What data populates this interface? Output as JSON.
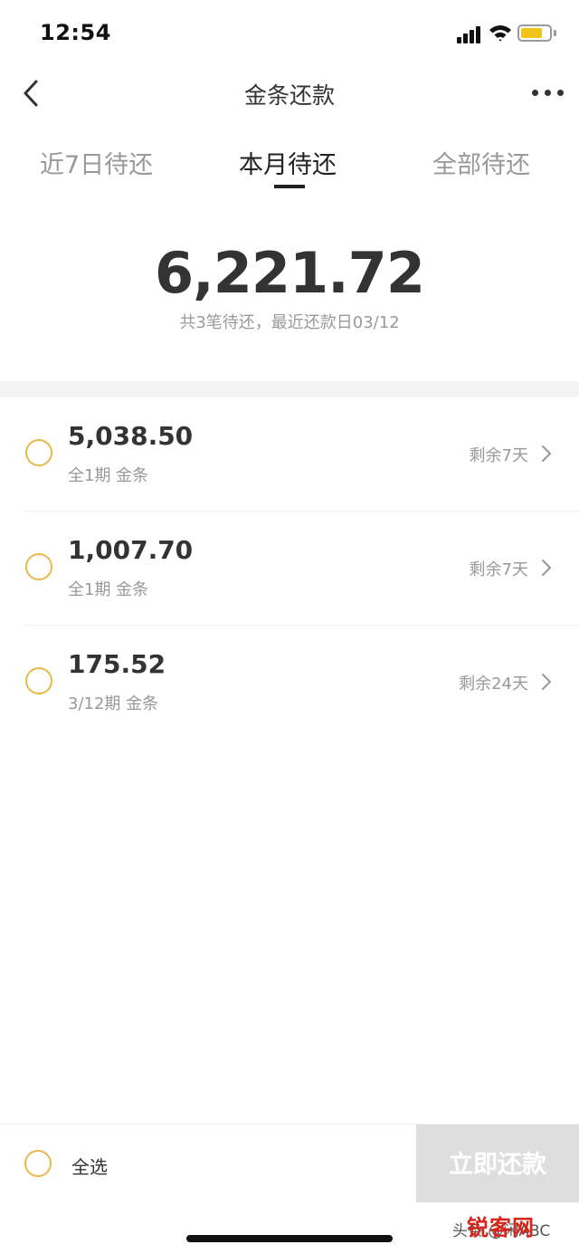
{
  "status_bar": {
    "time": "12:54",
    "battery_level": 0.75
  },
  "nav": {
    "title": "金条还款"
  },
  "tabs": [
    {
      "label": "近7日待还",
      "active": false
    },
    {
      "label": "本月待还",
      "active": true
    },
    {
      "label": "全部待还",
      "active": false
    }
  ],
  "summary": {
    "total_amount": "6,221.72",
    "subtitle": "共3笔待还，最近还款日03/12"
  },
  "bills": [
    {
      "amount": "5,038.50",
      "desc": "全1期  金条",
      "remaining": "剩余7天"
    },
    {
      "amount": "1,007.70",
      "desc": "全1期  金条",
      "remaining": "剩余7天"
    },
    {
      "amount": "175.52",
      "desc": "3/12期  金条",
      "remaining": "剩余24天"
    }
  ],
  "bottom_bar": {
    "select_all_label": "全选",
    "pay_button_label": "立即还款"
  },
  "watermark": {
    "text": "头条 @闲ABC",
    "logo_text": "锐客网"
  },
  "colors": {
    "accent": "#e8b84a",
    "battery": "#f2c318",
    "disabled_button": "#dedede"
  }
}
